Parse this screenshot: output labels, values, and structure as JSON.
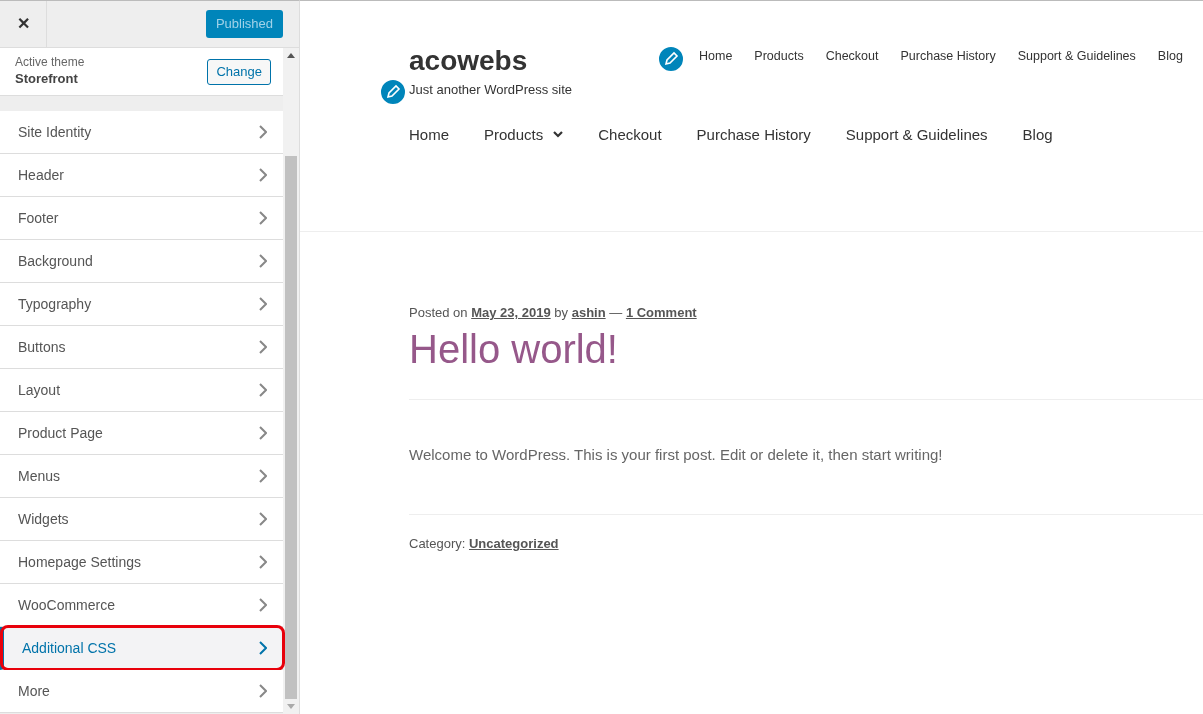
{
  "customizer": {
    "close": "✕",
    "publish_button": {
      "label": "Published",
      "disabled": true
    },
    "theme": {
      "caption": "Active theme",
      "name": "Storefront",
      "button": "Change"
    },
    "sections": [
      {
        "label": "Site Identity",
        "selected": false,
        "circled": false
      },
      {
        "label": "Header",
        "selected": false,
        "circled": false
      },
      {
        "label": "Footer",
        "selected": false,
        "circled": false
      },
      {
        "label": "Background",
        "selected": false,
        "circled": false
      },
      {
        "label": "Typography",
        "selected": false,
        "circled": false
      },
      {
        "label": "Buttons",
        "selected": false,
        "circled": false
      },
      {
        "label": "Layout",
        "selected": false,
        "circled": false
      },
      {
        "label": "Product Page",
        "selected": false,
        "circled": false
      },
      {
        "label": "Menus",
        "selected": false,
        "circled": false
      },
      {
        "label": "Widgets",
        "selected": false,
        "circled": false
      },
      {
        "label": "Homepage Settings",
        "selected": false,
        "circled": false
      },
      {
        "label": "WooCommerce",
        "selected": false,
        "circled": false
      },
      {
        "label": "Additional CSS",
        "selected": true,
        "circled": true
      },
      {
        "label": "More",
        "selected": false,
        "circled": false
      }
    ]
  },
  "preview": {
    "site_title": "acowebs",
    "tagline": "Just another WordPress site",
    "secondary_menu": [
      "Home",
      "Products",
      "Checkout",
      "Purchase History",
      "Support & Guidelines",
      "Blog"
    ],
    "primary_menu": [
      {
        "label": "Home",
        "dropdown": false
      },
      {
        "label": "Products",
        "dropdown": true
      },
      {
        "label": "Checkout",
        "dropdown": false
      },
      {
        "label": "Purchase History",
        "dropdown": false
      },
      {
        "label": "Support & Guidelines",
        "dropdown": false
      },
      {
        "label": "Blog",
        "dropdown": false
      }
    ],
    "post": {
      "meta": [
        {
          "text": "Posted on",
          "link": false
        },
        {
          "text": "May 23, 2019",
          "link": true
        },
        {
          "text": "by",
          "link": false
        },
        {
          "text": "ashin",
          "link": true
        },
        {
          "text": "—",
          "link": false
        },
        {
          "text": "1 Comment",
          "link": true
        }
      ],
      "title": "Hello world!",
      "body": "Welcome to WordPress. This is your first post. Edit or delete it, then start writing!",
      "category_label": "Category:",
      "category": "Uncategorized"
    }
  }
}
